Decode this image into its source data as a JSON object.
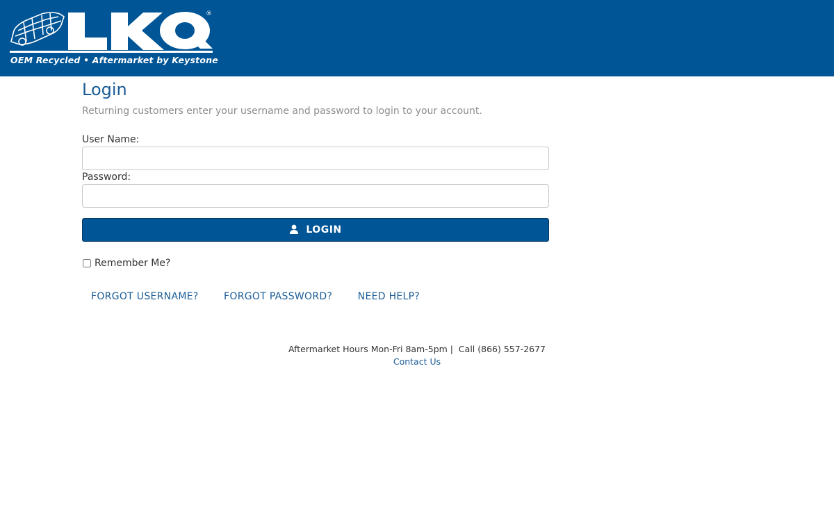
{
  "header": {
    "logo_text": "LKQ",
    "logo_registered": "®",
    "tagline": "OEM Recycled • Aftermarket by Keystone",
    "brand_color": "#005596"
  },
  "login": {
    "title": "Login",
    "subtitle": "Returning customers enter your username and password to login to your account.",
    "username_label": "User Name:",
    "username_value": "",
    "password_label": "Password:",
    "password_value": "",
    "button_label": "LOGIN",
    "button_icon": "user-icon",
    "remember_label": "Remember Me?",
    "remember_checked": false
  },
  "help_links": {
    "forgot_username": "FORGOT USERNAME?",
    "forgot_password": "FORGOT PASSWORD?",
    "need_help": "NEED HELP?"
  },
  "footer": {
    "hours_text": "Aftermarket Hours Mon-Fri 8am-5pm |  Call (866) 557-2677",
    "contact_link": "Contact Us"
  }
}
